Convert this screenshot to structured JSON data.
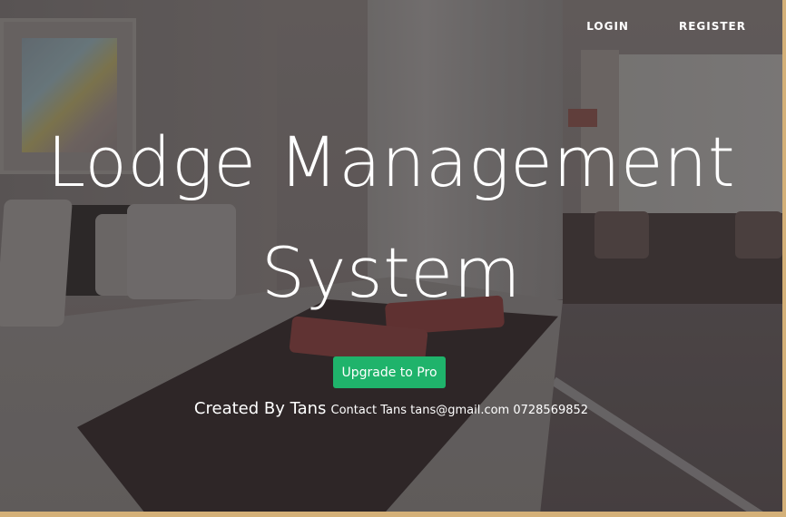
{
  "nav": {
    "login": "LOGIN",
    "register": "REGISTER"
  },
  "hero": {
    "title": "Lodge Management System",
    "cta": "Upgrade to Pro",
    "credit": "Created By Tans",
    "contact": "Contact Tans tans@gmail.com 0728569852"
  },
  "colors": {
    "cta_background": "#1fb36b",
    "text": "#ffffff",
    "frame": "#d4b078"
  }
}
